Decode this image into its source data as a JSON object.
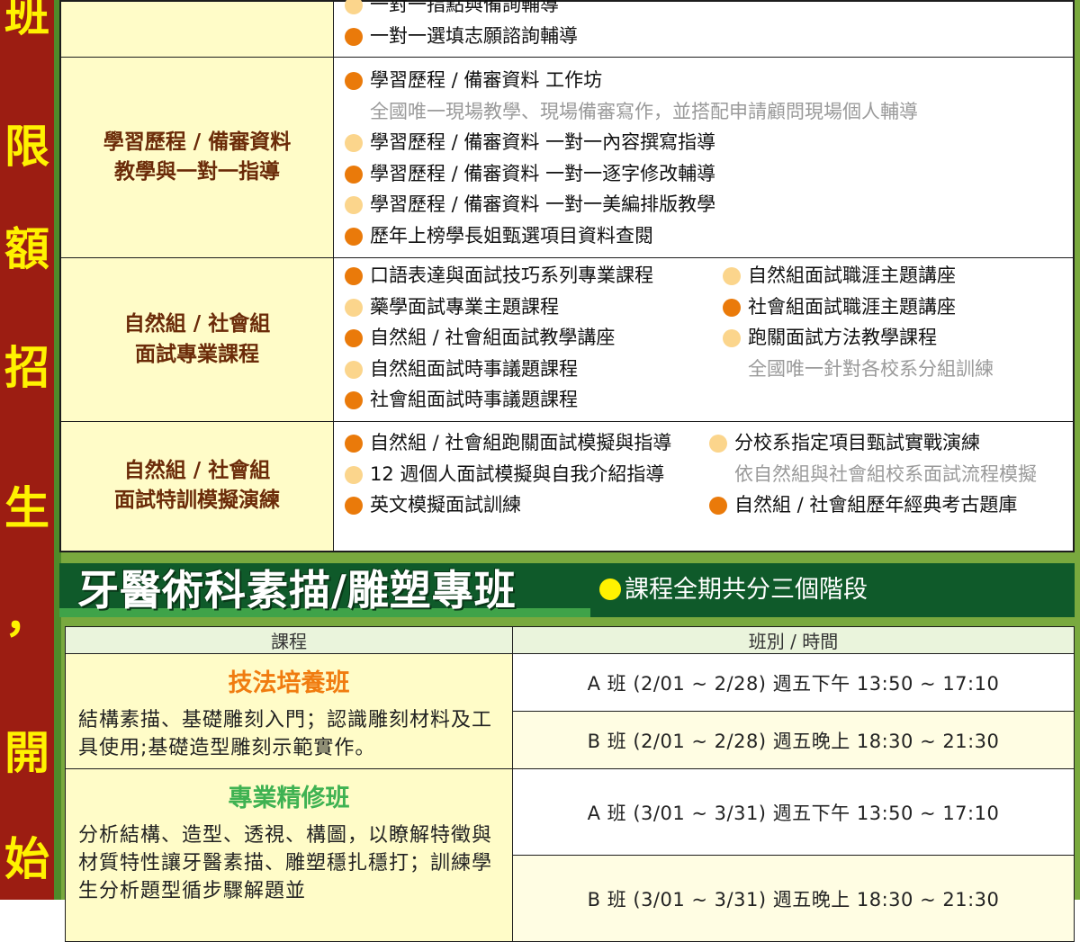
{
  "side_banner": [
    "班",
    "限",
    "額",
    "招",
    "生",
    "，",
    "開",
    "始"
  ],
  "top_rows": [
    {
      "category": "",
      "items": [
        {
          "dot": "yellow",
          "text": "一對一指點與備詢輔導"
        },
        {
          "dot": "orange",
          "text": "一對一選填志願諮詢輔導"
        }
      ]
    },
    {
      "category_lines": [
        "學習歷程 / 備審資料",
        "教學與一對一指導"
      ],
      "items": [
        {
          "dot": "orange",
          "text": "學習歷程 / 備審資料 工作坊"
        },
        {
          "dot": "none",
          "text": "全國唯一現場教學、現場備審寫作，並搭配申請顧問現場個人輔導"
        },
        {
          "dot": "yellow",
          "text": "學習歷程 / 備審資料 一對一內容撰寫指導"
        },
        {
          "dot": "orange",
          "text": "學習歷程 / 備審資料 一對一逐字修改輔導"
        },
        {
          "dot": "yellow",
          "text": "學習歷程 / 備審資料 一對一美編排版教學"
        },
        {
          "dot": "orange",
          "text": "歷年上榜學長姐甄選項目資料查閱"
        }
      ]
    },
    {
      "category_lines": [
        "自然組 / 社會組",
        "面試專業課程"
      ],
      "col1": [
        {
          "dot": "orange",
          "text": "口語表達與面試技巧系列專業課程"
        },
        {
          "dot": "yellow",
          "text": "藥學面試專業主題課程"
        },
        {
          "dot": "orange",
          "text": "自然組 / 社會組面試教學講座"
        },
        {
          "dot": "yellow",
          "text": "自然組面試時事議題課程"
        },
        {
          "dot": "orange",
          "text": "社會組面試時事議題課程"
        }
      ],
      "col2": [
        {
          "dot": "yellow",
          "text": "自然組面試職涯主題講座"
        },
        {
          "dot": "orange",
          "text": "社會組面試職涯主題講座"
        },
        {
          "dot": "yellow",
          "text": "跑關面試方法教學課程"
        },
        {
          "dot": "none",
          "text": "全國唯一針對各校系分組訓練"
        }
      ]
    },
    {
      "category_lines": [
        "自然組 / 社會組",
        "面試特訓模擬演練"
      ],
      "col1": [
        {
          "dot": "orange",
          "text": "自然組 / 社會組跑關面試模擬與指導"
        },
        {
          "dot": "yellow",
          "text": "12 週個人面試模擬與自我介紹指導"
        },
        {
          "dot": "orange",
          "text": "英文模擬面試訓練"
        }
      ],
      "col2": [
        {
          "dot": "yellow",
          "text": "分校系指定項目甄試實戰演練"
        },
        {
          "dot": "none",
          "text": "依自然組與社會組校系面試流程模擬"
        },
        {
          "dot": "orange",
          "text": "自然組 / 社會組歷年經典考古題庫"
        }
      ]
    }
  ],
  "dental_section": {
    "title": "牙醫術科素描/雕塑專班",
    "subtitle": "課程全期共分三個階段",
    "col_course": "課程",
    "col_time": "班別 / 時間",
    "courses": [
      {
        "name": "技法培養班",
        "desc": "結構素描、基礎雕刻入門；認識雕刻材料及工具使用;基礎造型雕刻示範實作。",
        "slots": [
          "A 班 (2/01 ~ 2/28) 週五下午 13:50 ~ 17:10",
          "B 班 (2/01 ~ 2/28) 週五晚上 18:30 ~ 21:30"
        ]
      },
      {
        "name": "專業精修班",
        "desc": "分析結構、造型、透視、構圖，以瞭解特徵與材質特性讓牙醫素描、雕塑穩扎穩打；訓練學生分析題型循步驟解題並",
        "slots": [
          "A 班 (3/01 ~ 3/31) 週五下午 13:50 ~ 17:10",
          "B 班 (3/01 ~ 3/31) 週五晚上 18:30 ~ 21:30"
        ]
      }
    ]
  },
  "colors": {
    "banner_red": "#9c1d12",
    "banner_text": "#fff200",
    "frame_green": "#79a93e",
    "header_green": "#0f5a2a",
    "category_bg": "#fffcc8",
    "category_text": "#6b2b09",
    "dot_orange": "#ea7a0a",
    "dot_yellow": "#fbd58c",
    "course_orange": "#f07c10",
    "course_green": "#3fb252"
  }
}
